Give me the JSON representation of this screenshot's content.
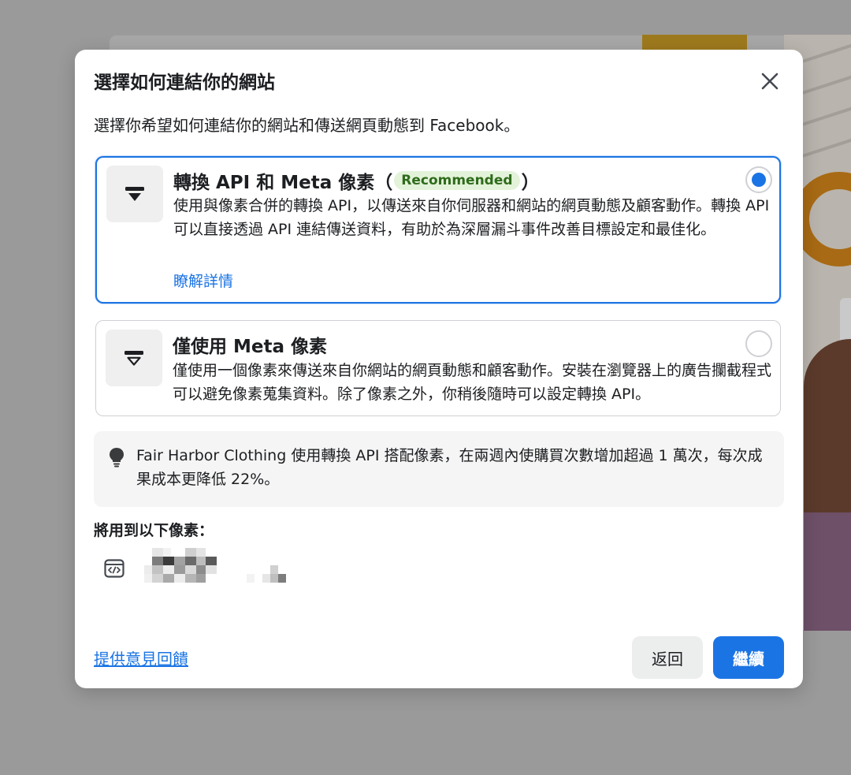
{
  "dialog": {
    "title": "選擇如何連結你的網站",
    "subtitle": "選擇你希望如何連結你的網站和傳送網頁動態到 Facebook。"
  },
  "options": [
    {
      "title": "轉換 API 和 Meta 像素",
      "paren_open": "（",
      "badge": "Recommended",
      "paren_close": "）",
      "description": "使用與像素合併的轉換 API，以傳送來自你伺服器和網站的網頁動態及顧客動作。轉換 API 可以直接透過 API 連結傳送資料，有助於為深層漏斗事件改善目標設定和最佳化。",
      "link": "瞭解詳情",
      "selected": true
    },
    {
      "title": "僅使用 Meta 像素",
      "description": "僅使用一個像素來傳送來自你網站的網頁動態和顧客動作。安裝在瀏覽器上的廣告攔截程式可以避免像素蒐集資料。除了像素之外，你稍後隨時可以設定轉換 API。",
      "selected": false
    }
  ],
  "tip": {
    "icon": "lightbulb-icon",
    "text": "Fair Harbor Clothing 使用轉換 API 搭配像素，在兩週內使購買次數增加超過 1 萬次，每次成果成本更降低 22%。"
  },
  "pixels": {
    "label": "將用到以下像素：",
    "icon": "code-window-icon"
  },
  "footer": {
    "feedback_link": "提供意見回饋",
    "back_label": "返回",
    "continue_label": "繼續"
  },
  "colors": {
    "accent": "#1b74e4",
    "badge_bg": "#e3f3d9",
    "badge_text": "#2f6b1c"
  }
}
